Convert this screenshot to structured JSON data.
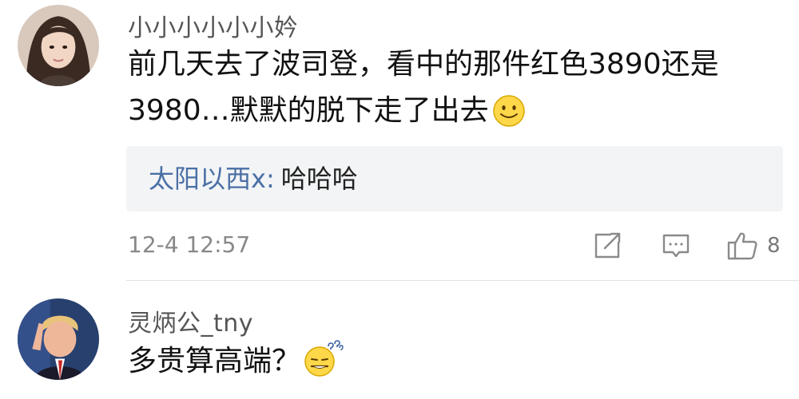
{
  "comments": [
    {
      "username": "小小小小小小妗",
      "text": "前几天去了波司登，看中的那件红色3890还是3980…默默的脱下走了出去",
      "emoji": "smile-emoji",
      "reply": {
        "username": "太阳以西x",
        "separator": ":",
        "text": "哈哈哈"
      },
      "timestamp": "12-4 12:57",
      "like_count": "8",
      "icons": [
        "share-icon",
        "comment-icon",
        "thumbs-up-icon"
      ]
    },
    {
      "username": "灵炳公_tny",
      "text": "多贵算高端？",
      "emoji": "thinking-emoji"
    }
  ],
  "colors": {
    "reply_username": "#4a6fa5",
    "reply_background": "#f3f4f6",
    "meta_gray": "#888888"
  }
}
